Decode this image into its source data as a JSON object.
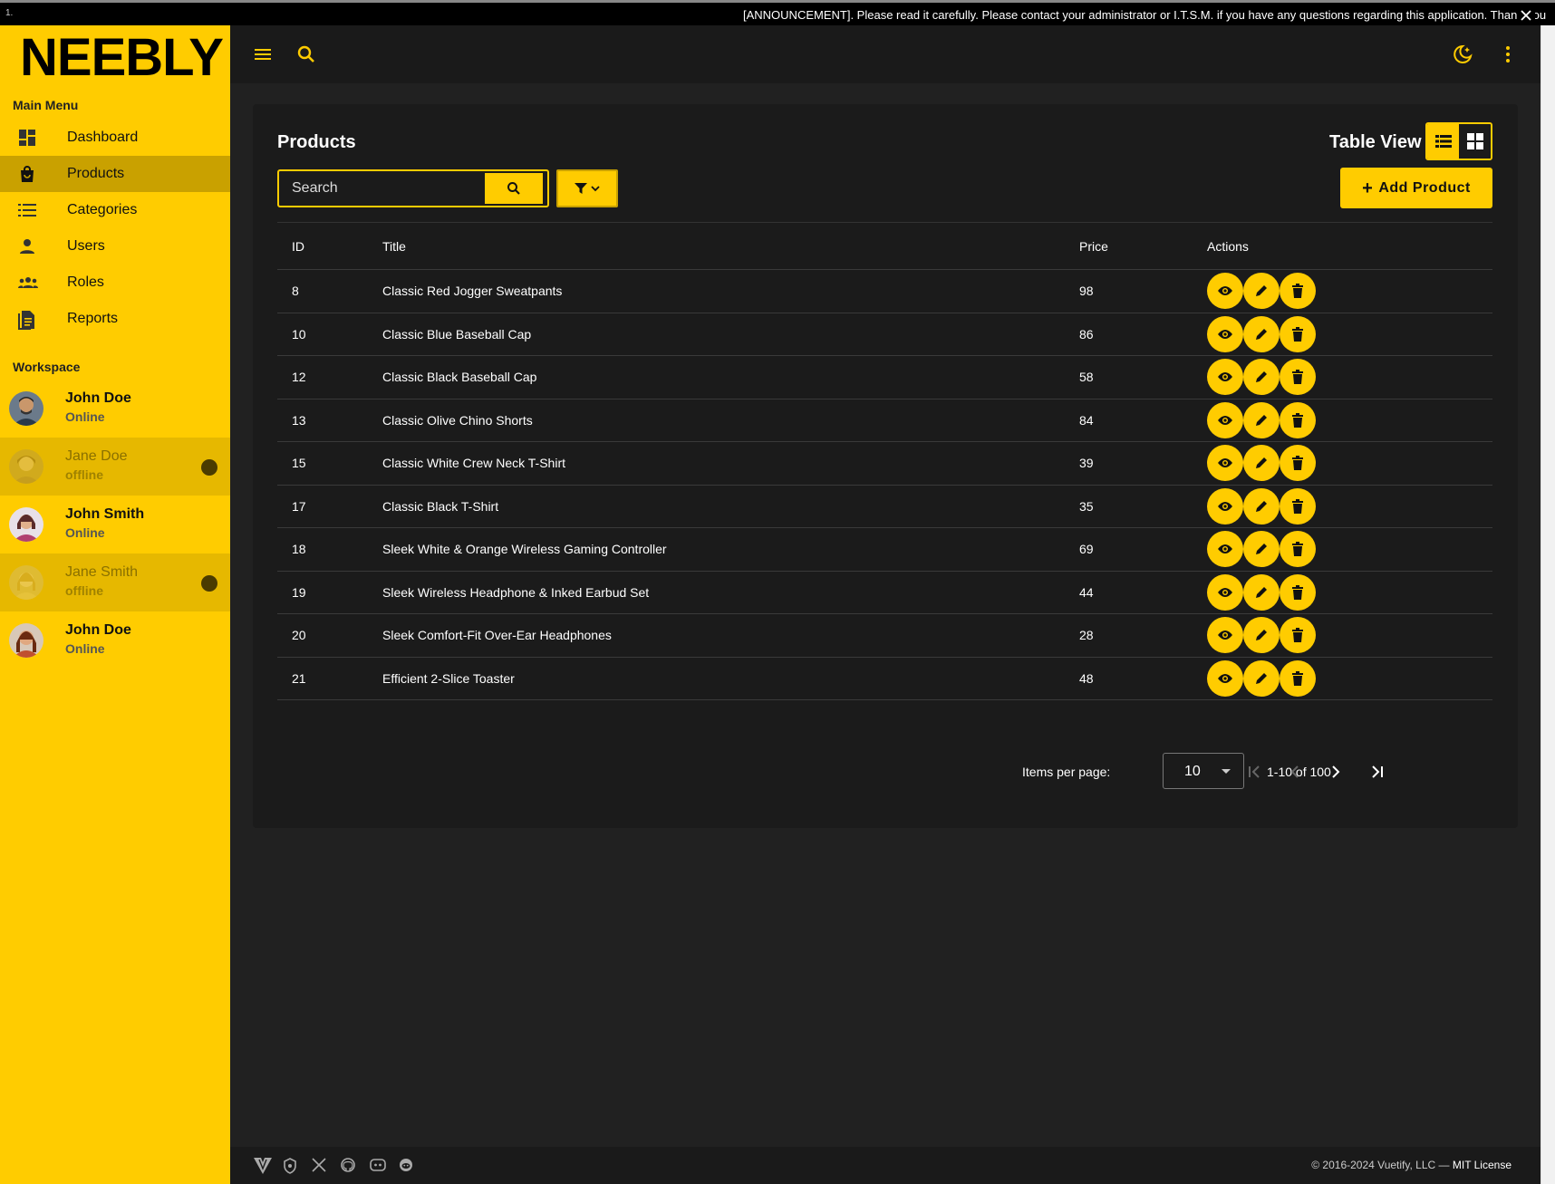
{
  "announcement": {
    "marker": "1.",
    "text": "[ANNOUNCEMENT]. Please read it carefully. Please contact your administrator or I.T.S.M. if you have any questions regarding this application. Thank You"
  },
  "sidebar": {
    "logo": "NEEBLY",
    "main_menu_title": "Main Menu",
    "items": [
      {
        "label": "Dashboard",
        "icon": "dashboard-icon"
      },
      {
        "label": "Products",
        "icon": "shopping-bag-icon",
        "active": true
      },
      {
        "label": "Categories",
        "icon": "list-icon"
      },
      {
        "label": "Users",
        "icon": "person-icon"
      },
      {
        "label": "Roles",
        "icon": "group-icon"
      },
      {
        "label": "Reports",
        "icon": "document-icon"
      }
    ],
    "workspace_title": "Workspace",
    "workspace": [
      {
        "name": "John Doe",
        "status": "Online"
      },
      {
        "name": "Jane Doe",
        "status": "offline"
      },
      {
        "name": "John Smith",
        "status": "Online"
      },
      {
        "name": "Jane Smith",
        "status": "offline"
      },
      {
        "name": "John Doe",
        "status": "Online"
      }
    ]
  },
  "page": {
    "title": "Products",
    "view_label": "Table View",
    "search_placeholder": "Search",
    "add_button": "Add Product"
  },
  "table": {
    "headers": {
      "id": "ID",
      "title": "Title",
      "price": "Price",
      "actions": "Actions"
    },
    "rows": [
      {
        "id": "8",
        "title": "Classic Red Jogger Sweatpants",
        "price": "98"
      },
      {
        "id": "10",
        "title": "Classic Blue Baseball Cap",
        "price": "86"
      },
      {
        "id": "12",
        "title": "Classic Black Baseball Cap",
        "price": "58"
      },
      {
        "id": "13",
        "title": "Classic Olive Chino Shorts",
        "price": "84"
      },
      {
        "id": "15",
        "title": "Classic White Crew Neck T-Shirt",
        "price": "39"
      },
      {
        "id": "17",
        "title": "Classic Black T-Shirt",
        "price": "35"
      },
      {
        "id": "18",
        "title": "Sleek White & Orange Wireless Gaming Controller",
        "price": "69"
      },
      {
        "id": "19",
        "title": "Sleek Wireless Headphone & Inked Earbud Set",
        "price": "44"
      },
      {
        "id": "20",
        "title": "Sleek Comfort-Fit Over-Ear Headphones",
        "price": "28"
      },
      {
        "id": "21",
        "title": "Efficient 2-Slice Toaster",
        "price": "48"
      }
    ]
  },
  "pagination": {
    "items_per_page_label": "Items per page:",
    "items_per_page": "10",
    "range": "1-10 of 100"
  },
  "footer": {
    "copyright": "© 2016-2024 Vuetify, LLC —",
    "license": "MIT License"
  },
  "colors": {
    "accent": "#ffcc00",
    "background": "#212121",
    "surface": "#1b1b1b"
  }
}
